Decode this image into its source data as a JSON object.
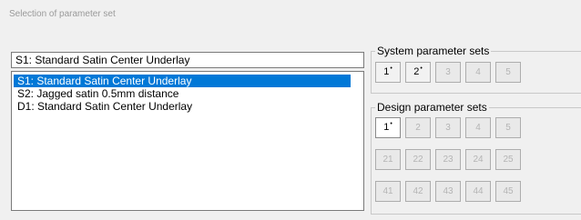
{
  "dialog": {
    "title": "Selection of parameter set"
  },
  "current_set": "S1: Standard Satin Center Underlay",
  "list": {
    "items": [
      {
        "label": "S1: Standard Satin Center Underlay",
        "selected": true
      },
      {
        "label": "S2: Jagged satin 0.5mm distance",
        "selected": false
      },
      {
        "label": "D1: Standard Satin Center Underlay",
        "selected": false
      }
    ]
  },
  "system_sets": {
    "label": "System parameter sets",
    "buttons": [
      {
        "label": "1",
        "star": "•",
        "enabled": true
      },
      {
        "label": "2",
        "star": "•",
        "enabled": true
      },
      {
        "label": "3",
        "enabled": false
      },
      {
        "label": "4",
        "enabled": false
      },
      {
        "label": "5",
        "enabled": false
      }
    ]
  },
  "design_sets": {
    "label": "Design parameter sets",
    "rows": [
      [
        {
          "label": "1",
          "star": "•",
          "enabled": true,
          "active": true
        },
        {
          "label": "2",
          "enabled": false
        },
        {
          "label": "3",
          "enabled": false
        },
        {
          "label": "4",
          "enabled": false
        },
        {
          "label": "5",
          "enabled": false
        }
      ],
      [
        {
          "label": "21",
          "enabled": false
        },
        {
          "label": "22",
          "enabled": false
        },
        {
          "label": "23",
          "enabled": false
        },
        {
          "label": "24",
          "enabled": false
        },
        {
          "label": "25",
          "enabled": false
        }
      ],
      [
        {
          "label": "41",
          "enabled": false
        },
        {
          "label": "42",
          "enabled": false
        },
        {
          "label": "43",
          "enabled": false
        },
        {
          "label": "44",
          "enabled": false
        },
        {
          "label": "45",
          "enabled": false
        }
      ]
    ]
  }
}
